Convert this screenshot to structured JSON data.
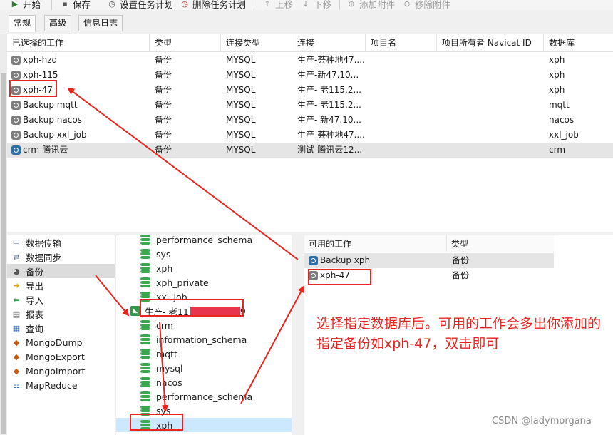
{
  "toolbar": {
    "start": "开始",
    "save": "保存",
    "set_schedule": "设置任务计划",
    "delete_schedule": "删除任务计划",
    "move_up": "上移",
    "move_down": "下移",
    "add_attachment": "添加附件",
    "remove_attachment": "移除附件"
  },
  "tabs": [
    "常规",
    "高级",
    "信息日志"
  ],
  "job_grid": {
    "columns": [
      "已选择的工作",
      "类型",
      "连接类型",
      "连接",
      "项目名",
      "项目所有者 Navicat ID",
      "数据库"
    ],
    "rows": [
      {
        "name": "xph-hzd",
        "type": "备份",
        "conn_type": "MYSQL",
        "conn": "生产-荟种地47....",
        "project": "",
        "owner": "",
        "db": "xph"
      },
      {
        "name": "xph-115",
        "type": "备份",
        "conn_type": "MYSQL",
        "conn": "生产-新47.10...",
        "project": "",
        "owner": "",
        "db": "xph"
      },
      {
        "name": "xph-47",
        "type": "备份",
        "conn_type": "MYSQL",
        "conn": "生产- 老115.2...",
        "project": "",
        "owner": "",
        "db": "xph"
      },
      {
        "name": "Backup mqtt",
        "type": "备份",
        "conn_type": "MYSQL",
        "conn": "生产- 老115.2...",
        "project": "",
        "owner": "",
        "db": "mqtt"
      },
      {
        "name": "Backup nacos",
        "type": "备份",
        "conn_type": "MYSQL",
        "conn": "生产- 新47.10...",
        "project": "",
        "owner": "",
        "db": "nacos"
      },
      {
        "name": "Backup xxl_job",
        "type": "备份",
        "conn_type": "MYSQL",
        "conn": "生产-荟种地47....",
        "project": "",
        "owner": "",
        "db": "xxl_job"
      },
      {
        "name": "crm-腾讯云",
        "type": "备份",
        "conn_type": "MYSQL",
        "conn": "测试-腾讯云12...",
        "project": "",
        "owner": "",
        "db": "crm"
      }
    ]
  },
  "sidebar": {
    "items": [
      {
        "label": "数据传输",
        "icon": "data-transfer-icon"
      },
      {
        "label": "数据同步",
        "icon": "data-sync-icon"
      },
      {
        "label": "备份",
        "icon": "backup-icon"
      },
      {
        "label": "导出",
        "icon": "export-icon"
      },
      {
        "label": "导入",
        "icon": "import-icon"
      },
      {
        "label": "报表",
        "icon": "report-icon"
      },
      {
        "label": "查询",
        "icon": "query-icon"
      },
      {
        "label": "MongoDump",
        "icon": "mongodump-icon"
      },
      {
        "label": "MongoExport",
        "icon": "mongoexport-icon"
      },
      {
        "label": "MongoImport",
        "icon": "mongoimport-icon"
      },
      {
        "label": "MapReduce",
        "icon": "mapreduce-icon"
      }
    ]
  },
  "tree": {
    "before_server": [
      "performance_schema",
      "sys",
      "xph",
      "xph_private",
      "xxl_job"
    ],
    "server": "生产- 老11",
    "server_suffix": "9",
    "after_server": [
      "crm",
      "information_schema",
      "mqtt",
      "mysql",
      "nacos",
      "performance_schema",
      "sys",
      "xph"
    ]
  },
  "available_jobs": {
    "columns": [
      "可用的工作",
      "类型"
    ],
    "rows": [
      {
        "name": "Backup xph",
        "type": "备份"
      },
      {
        "name": "xph-47",
        "type": "备份"
      }
    ]
  },
  "annotation": "选择指定数据库后。可用的工作会多出你添加的指定备份如xph-47，双击即可",
  "watermark": "CSDN @ladymorgana",
  "colors": {
    "annotation_red": "#e8251f",
    "selection_blue": "#cce8ff",
    "db_green": "#3aa84e"
  }
}
